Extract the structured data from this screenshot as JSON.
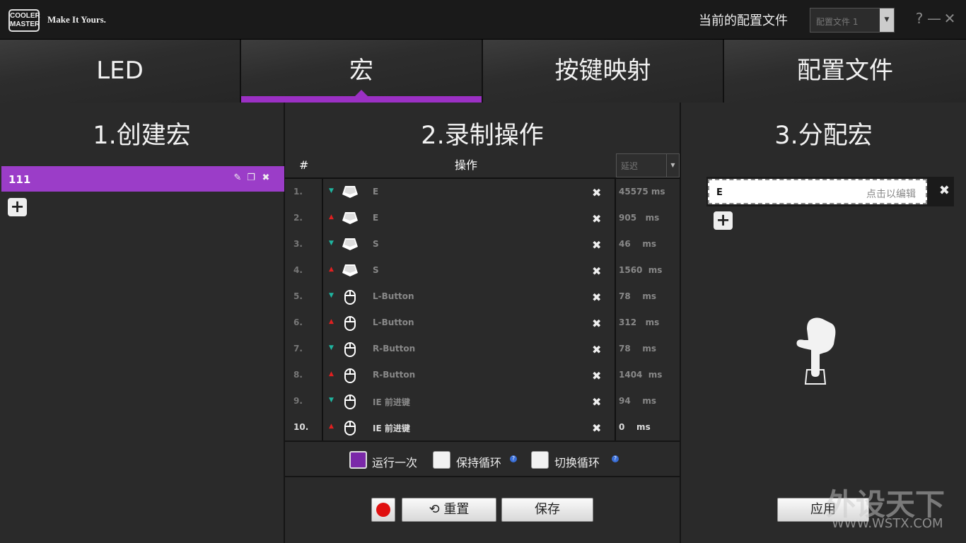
{
  "header": {
    "logo_text": "COOLER MASTER",
    "tagline": "Make It Yours.",
    "profile_label": "当前的配置文件",
    "profile_value": "配置文件 1",
    "help": "?",
    "minimize": "—",
    "close": "✕"
  },
  "tabs": [
    {
      "label": "LED",
      "active": false
    },
    {
      "label": "宏",
      "active": true
    },
    {
      "label": "按键映射",
      "active": false
    },
    {
      "label": "配置文件",
      "active": false
    }
  ],
  "panel1": {
    "title": "1.创建宏",
    "macros": [
      {
        "name": "111"
      }
    ],
    "add_label": "+"
  },
  "panel2": {
    "title": "2.录制操作",
    "col_num": "#",
    "col_action": "操作",
    "delay_select": "延迟",
    "rows": [
      {
        "num": "1.",
        "dir": "down",
        "icon": "keycap-icon",
        "name": "E",
        "delay": "45575 ms"
      },
      {
        "num": "2.",
        "dir": "up",
        "icon": "keycap-icon",
        "name": "E",
        "delay": "905   ms"
      },
      {
        "num": "3.",
        "dir": "down",
        "icon": "keycap-icon",
        "name": "S",
        "delay": "46    ms"
      },
      {
        "num": "4.",
        "dir": "up",
        "icon": "keycap-icon",
        "name": "S",
        "delay": "1560  ms"
      },
      {
        "num": "5.",
        "dir": "down",
        "icon": "mouse-icon",
        "name": "L-Button",
        "delay": "78    ms"
      },
      {
        "num": "6.",
        "dir": "up",
        "icon": "mouse-icon",
        "name": "L-Button",
        "delay": "312   ms"
      },
      {
        "num": "7.",
        "dir": "down",
        "icon": "mouse-icon",
        "name": "R-Button",
        "delay": "78    ms"
      },
      {
        "num": "8.",
        "dir": "up",
        "icon": "mouse-icon",
        "name": "R-Button",
        "delay": "1404  ms"
      },
      {
        "num": "9.",
        "dir": "down",
        "icon": "mouse-icon",
        "name": "IE 前进键",
        "delay": "94    ms"
      },
      {
        "num": "10.",
        "dir": "up",
        "icon": "mouse-icon",
        "name": "IE 前进键",
        "delay": "0    ms"
      }
    ],
    "options": [
      {
        "label": "运行一次",
        "checked": true
      },
      {
        "label": "保持循环",
        "checked": false
      },
      {
        "label": "切换循环",
        "checked": false
      }
    ],
    "reset_label": "重置",
    "save_label": "保存"
  },
  "panel3": {
    "title": "3.分配宏",
    "assigned_key": "E",
    "edit_hint": "点击以编辑",
    "add_label": "+",
    "apply_label": "应用"
  },
  "watermark": {
    "line1": "外设天下",
    "line2": "WWW.WSTX.COM"
  },
  "colors": {
    "accent": "#9b30c4",
    "down_arrow": "#1fb5a0",
    "up_arrow": "#e02020",
    "record": "#e01010"
  }
}
